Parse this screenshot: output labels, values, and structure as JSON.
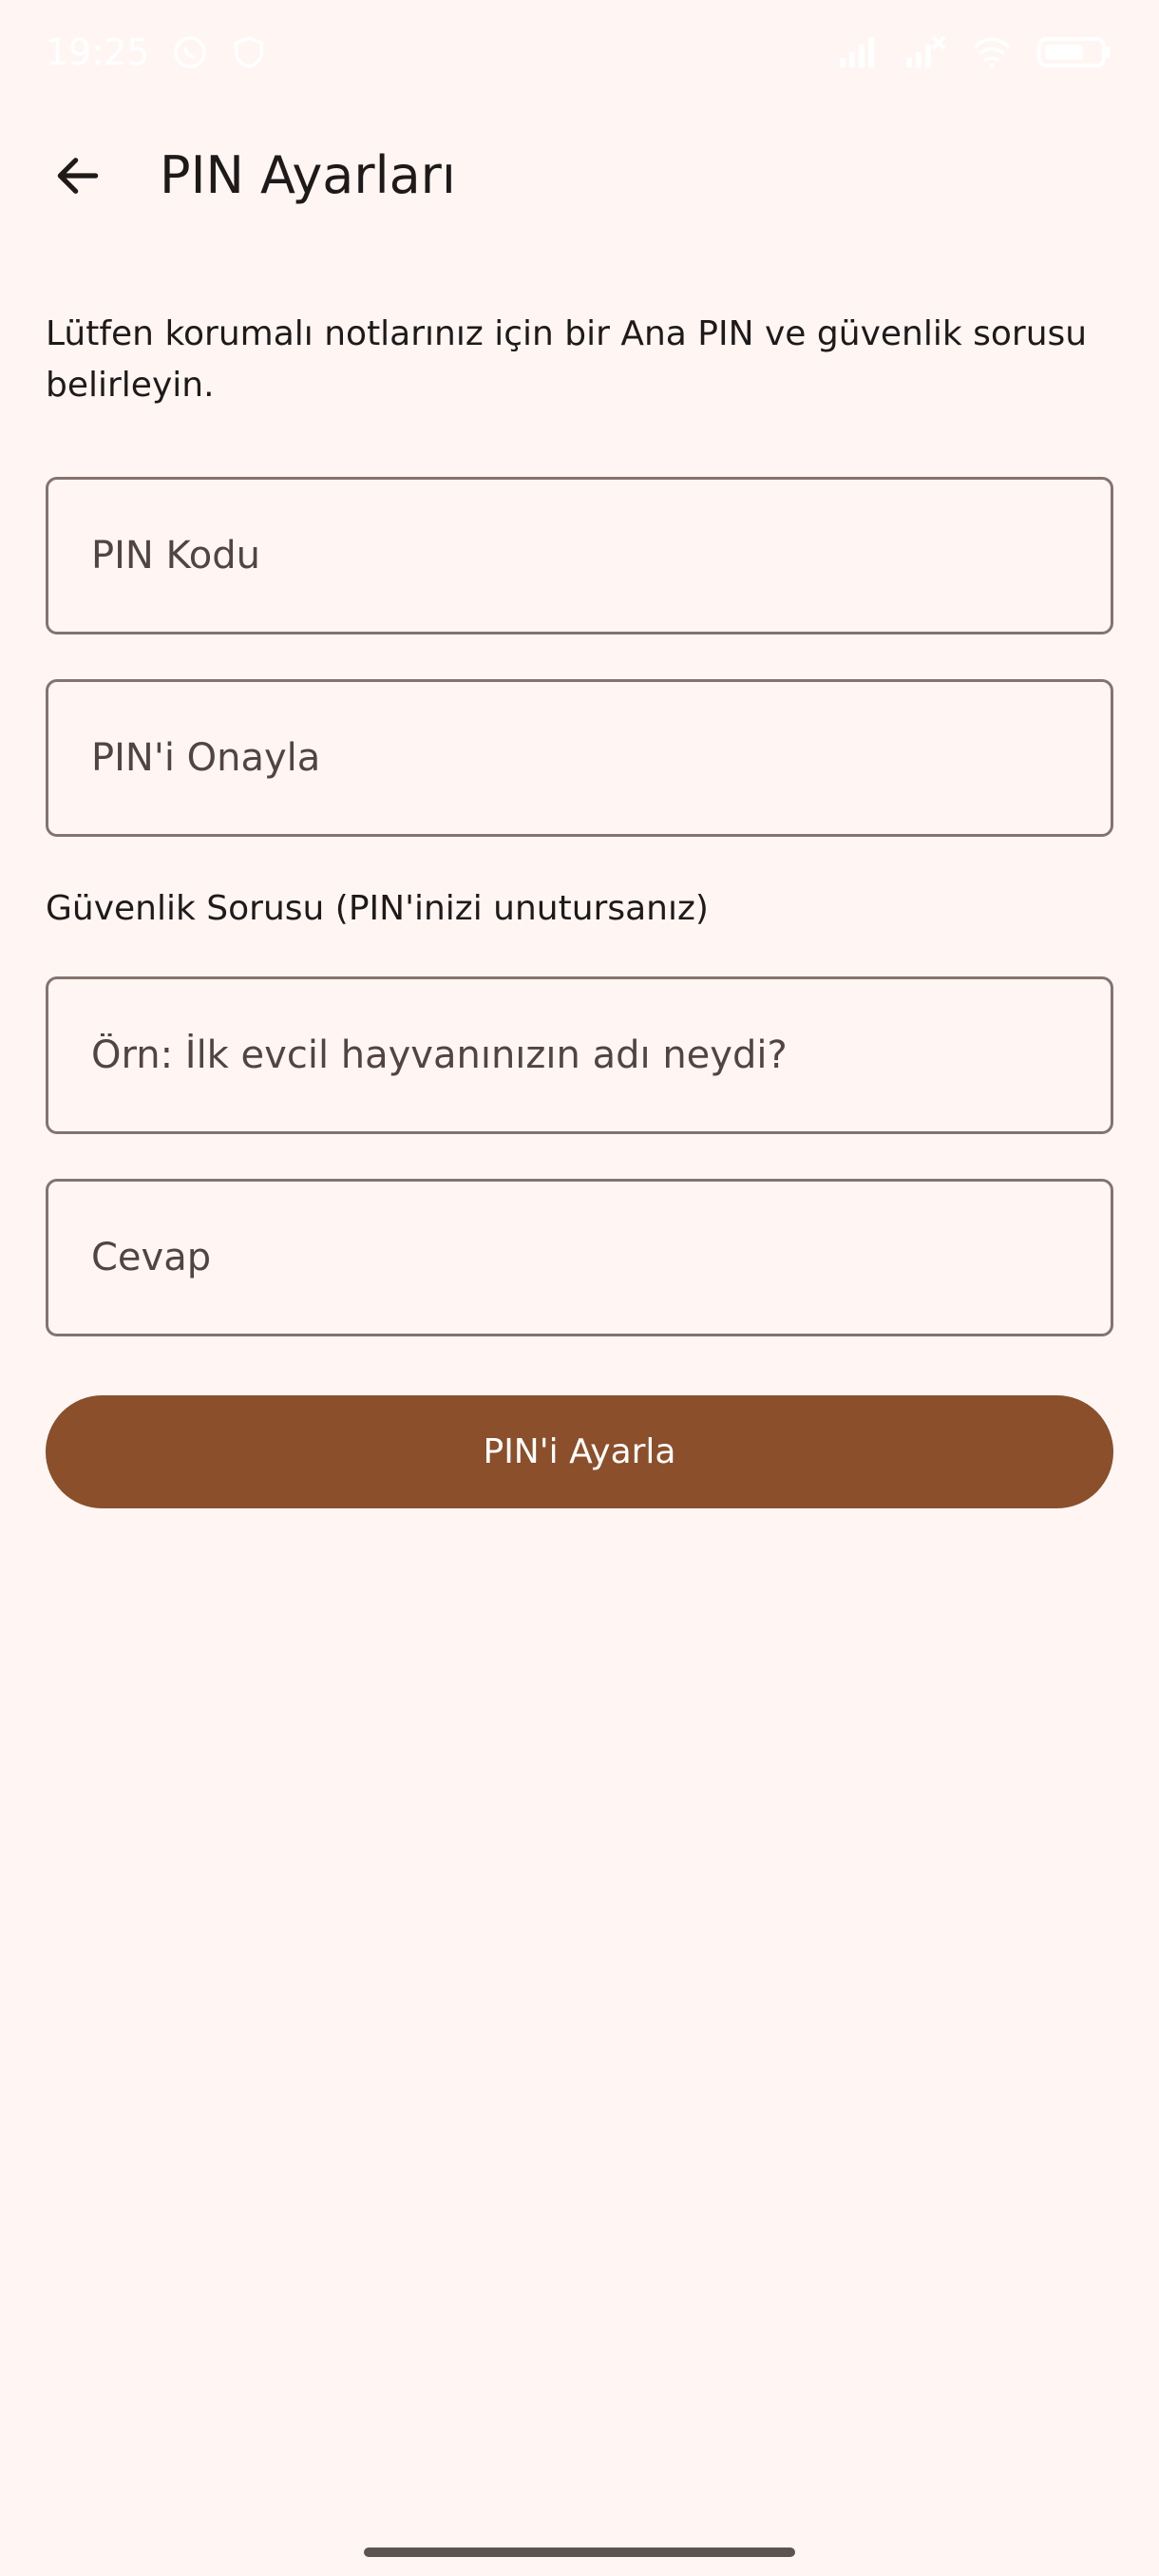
{
  "status_bar": {
    "time": "19:25",
    "icons": [
      "whatsapp-icon",
      "vpn-shield-icon",
      "signal-icon",
      "signal-x-icon",
      "wifi-icon",
      "battery-icon"
    ]
  },
  "app_bar": {
    "back_icon": "arrow-back-icon",
    "title": "PIN Ayarları"
  },
  "intro_text": "Lütfen korumalı notlarınız için bir Ana PIN ve güvenlik sorusu belirleyin.",
  "form": {
    "pin_field": {
      "placeholder": "PIN Kodu",
      "value": ""
    },
    "confirm_field": {
      "placeholder": "PIN'i Onayla",
      "value": ""
    },
    "security_label": "Güvenlik Sorusu (PIN'inizi unutursanız)",
    "question_field": {
      "placeholder": "Örn: İlk evcil hayvanınızın adı neydi?",
      "value": ""
    },
    "answer_field": {
      "placeholder": "Cevap",
      "value": ""
    },
    "submit_label": "PIN'i Ayarla"
  },
  "colors": {
    "background": "#FFF6F4",
    "primary": "#8B4F2B",
    "outline": "#85736E",
    "text": "#1E1A19"
  }
}
